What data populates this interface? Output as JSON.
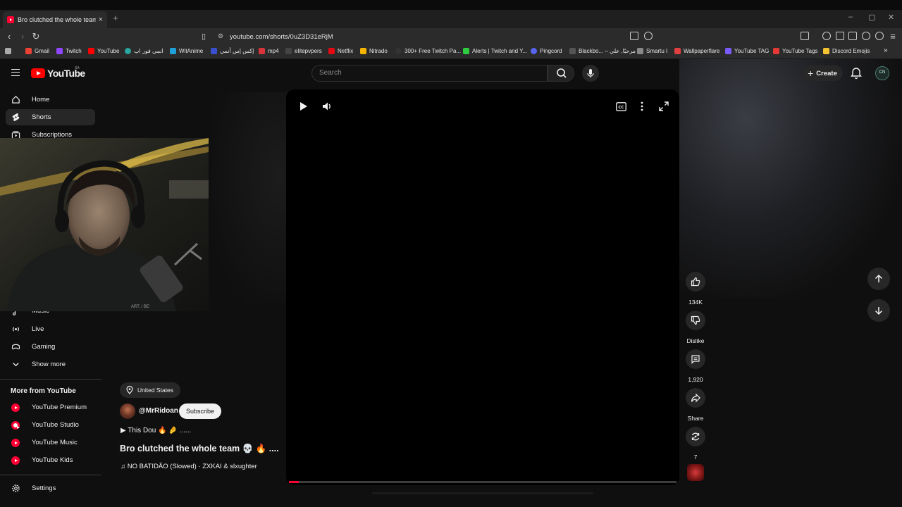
{
  "browser": {
    "tab_title": "Bro clutched the whole team 💀",
    "tab_close": "×",
    "new_tab": "+",
    "window_controls": [
      "–",
      "▢",
      "✕"
    ],
    "url": "youtube.com/shorts/0uZ3D31eRjM",
    "bookmarks": [
      {
        "label": "Gmail",
        "color": "#ea4335"
      },
      {
        "label": "Twitch",
        "color": "#9146ff"
      },
      {
        "label": "YouTube",
        "color": "#ff0000"
      },
      {
        "label": "انمي فور اب",
        "color": "#2aa7a0"
      },
      {
        "label": "WitAnime",
        "color": "#1fa0d8"
      },
      {
        "label": "إكس إس أنمي",
        "color": "#3a4fd0"
      },
      {
        "label": "mp4",
        "color": "#d9343c"
      },
      {
        "label": "elitepvpers",
        "color": "#444444"
      },
      {
        "label": "Netflix",
        "color": "#e50914"
      },
      {
        "label": "Nitrado",
        "color": "#f4b400"
      },
      {
        "label": "300+ Free Twitch Pa...",
        "color": "#333333"
      },
      {
        "label": "Alerts | Twitch and Y...",
        "color": "#2ecc40"
      },
      {
        "label": "Pingcord",
        "color": "#5865f2"
      },
      {
        "label": "Blackbo... – مرحبًا, علي",
        "color": "#555555"
      },
      {
        "label": "Smartu I",
        "color": "#888888"
      },
      {
        "label": "Wallpaperflare",
        "color": "#e04040"
      },
      {
        "label": "YouTube TAG",
        "color": "#7a5af8"
      },
      {
        "label": "YouTube Tags",
        "color": "#e53935"
      },
      {
        "label": "Discord Emojis",
        "color": "#f4c430"
      }
    ],
    "bookmarks_more": "»"
  },
  "youtube": {
    "logo": "YouTube",
    "country": "SA",
    "search_placeholder": "Search",
    "create_label": "Create",
    "avatar_text": "CN"
  },
  "sidebar": {
    "top": [
      {
        "label": "Home",
        "icon": "home-icon"
      },
      {
        "label": "Shorts",
        "icon": "shorts-icon",
        "active": true
      },
      {
        "label": "Subscriptions",
        "icon": "subscriptions-icon"
      }
    ],
    "explore": [
      {
        "label": "Music",
        "icon": "music-icon"
      },
      {
        "label": "Live",
        "icon": "live-icon"
      },
      {
        "label": "Gaming",
        "icon": "gaming-icon"
      },
      {
        "label": "Show more",
        "icon": "chevron-down-icon"
      }
    ],
    "more_title": "More from YouTube",
    "more": [
      {
        "label": "YouTube Premium"
      },
      {
        "label": "YouTube Studio"
      },
      {
        "label": "YouTube Music"
      },
      {
        "label": "YouTube Kids"
      }
    ],
    "settings": "Settings"
  },
  "webcam": {
    "watermark": "ART. / BE"
  },
  "video": {
    "location": "United States",
    "channel": "@MrRidoan",
    "subscribe": "Subscribe",
    "description": "▶ This Dou 🔥 🤌 ......",
    "title": "Bro clutched the whole team 💀 🔥 ....",
    "music": "♫ NO BATIDÃO (Slowed) · ZXKAI & slxughter",
    "progress_fraction": 0.025
  },
  "actions": {
    "likes": "134K",
    "dislike": "Dislike",
    "comments": "1,920",
    "share": "Share",
    "remix": "7"
  }
}
